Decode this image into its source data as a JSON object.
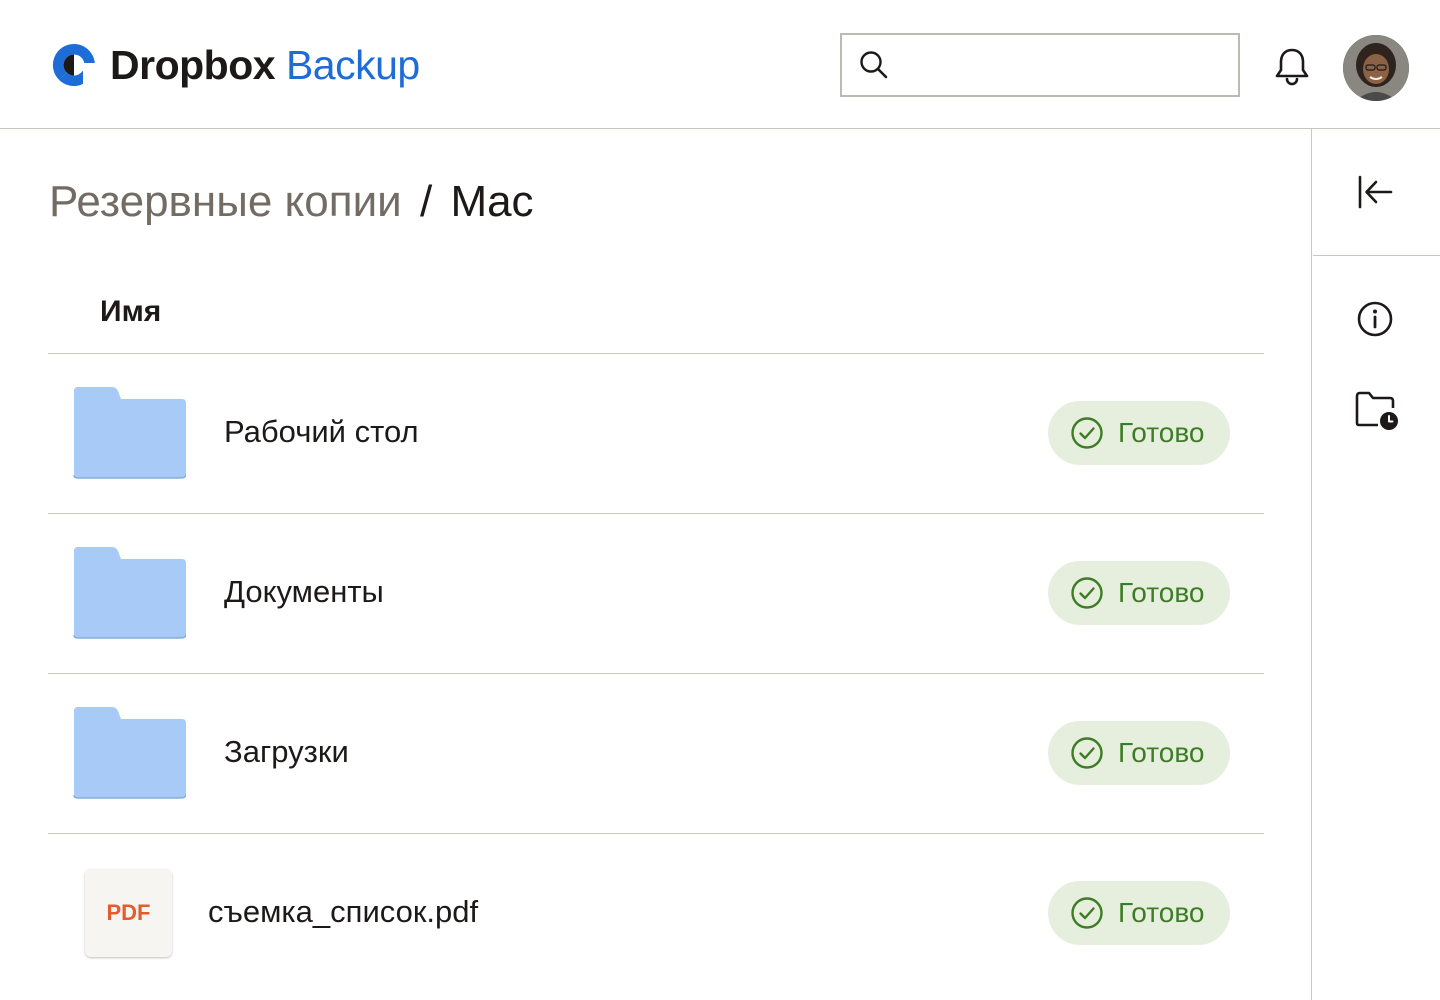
{
  "header": {
    "brand": "Dropbox",
    "product": "Backup",
    "search": {
      "value": "",
      "placeholder": ""
    },
    "logo_icon": "dropbox-backup-logo-icon",
    "notification_icon": "bell-icon",
    "avatar": "user-avatar"
  },
  "breadcrumb": {
    "root": "Резервные копии",
    "separator": "/",
    "current": "Mac"
  },
  "table": {
    "column_name": "Имя",
    "rows": [
      {
        "type": "folder",
        "name": "Рабочий стол",
        "status": "Готово"
      },
      {
        "type": "folder",
        "name": "Документы",
        "status": "Готово"
      },
      {
        "type": "folder",
        "name": "Загрузки",
        "status": "Готово"
      },
      {
        "type": "file",
        "file_label": "PDF",
        "name": "съемка_список.pdf",
        "status": "Готово"
      }
    ]
  },
  "rail": {
    "icons": [
      "collapse-panel-icon",
      "info-icon",
      "folder-history-icon"
    ]
  },
  "colors": {
    "accent": "#1e6dd6",
    "folder": "#a7cbf6",
    "status_bg": "#e6eedd",
    "status_text": "#3e7d26",
    "pdf": "#e35b2f"
  }
}
